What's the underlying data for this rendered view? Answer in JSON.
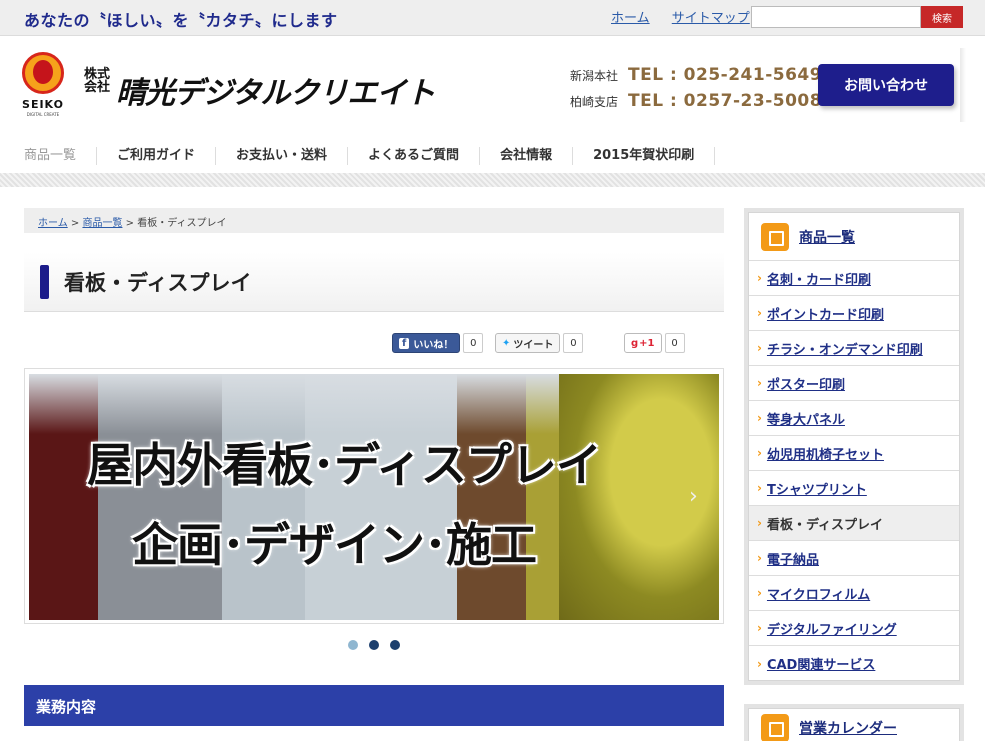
{
  "topbar": {
    "tagline": "あなたの〝ほしい〟を〝カタチ〟にします",
    "links": [
      "ホーム",
      "サイトマップ"
    ],
    "search_placeholder": "",
    "search_button": "検索"
  },
  "header": {
    "logo_text": "SEIKO",
    "logo_sub": "DIGITAL CREATE",
    "company_prefix": "株式会社",
    "company_name": "晴光デジタルクリエイト",
    "tel": [
      {
        "branch": "新潟本社",
        "number": "TEL : 025-241-5649"
      },
      {
        "branch": "柏崎支店",
        "number": "TEL : 0257-23-5008"
      }
    ],
    "contact_button": "お問い合わせ"
  },
  "global_nav": [
    "商品一覧",
    "ご利用ガイド",
    "お支払い・送料",
    "よくあるご質問",
    "会社情報",
    "2015年賀状印刷"
  ],
  "breadcrumb": {
    "home": "ホーム",
    "sep": " > ",
    "products": "商品一覧",
    "current": "看板・ディスプレイ"
  },
  "page_title": "看板・ディスプレイ",
  "social": {
    "like_label": "いいね！",
    "like_count": "0",
    "tweet_label": "ツイート",
    "tweet_count": "0",
    "gplus_label": "+1",
    "gplus_count": "0"
  },
  "slider": {
    "line1": "屋内外看板･ディスプレイ",
    "line2": "企画･デザイン･施工",
    "next_glyph": "›",
    "active_index": 0,
    "dot_count": 3
  },
  "section_head": "業務内容",
  "sidebar": {
    "heading": "商品一覧",
    "items": [
      "名刺・カード印刷",
      "ポイントカード印刷",
      "チラシ・オンデマンド印刷",
      "ポスター印刷",
      "等身大パネル",
      "幼児用机椅子セット",
      "Tシャツプリント",
      "看板・ディスプレイ",
      "電子納品",
      "マイクロフィルム",
      "デジタルファイリング",
      "CAD関連サービス"
    ],
    "current_item": "看板・ディスプレイ",
    "heading2": "営業カレンダー"
  },
  "colors": {
    "brand_navy": "#1e1e8c",
    "accent_orange": "#f39a17",
    "tel_brown": "#8b6a3e",
    "search_red": "#c62828",
    "section_blue": "#2c40a8"
  },
  "icons": {
    "sidebar_heading": "box-icon",
    "facebook": "facebook-icon",
    "twitter": "twitter-icon",
    "gplus": "gplus-icon"
  }
}
